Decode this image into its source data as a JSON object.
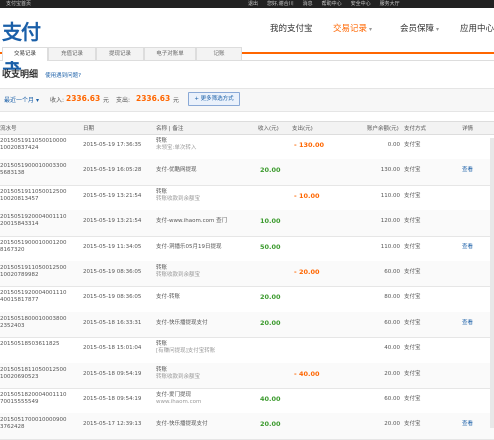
{
  "topbar": {
    "left": "支付宝首页",
    "links": [
      "退出",
      "您好,谢合川",
      "消息",
      "帮助中心",
      "安全中心",
      "服务大厅"
    ]
  },
  "header": {
    "logo": "支付宝",
    "nav": [
      {
        "label": "我的支付宝",
        "active": false,
        "caret": false
      },
      {
        "label": "交易记录",
        "active": true,
        "caret": true
      },
      {
        "label": "会员保障",
        "active": false,
        "caret": true
      },
      {
        "label": "应用中心",
        "active": false,
        "caret": true
      }
    ]
  },
  "subtabs": [
    "交易记录",
    "充值记录",
    "提现记录",
    "电子对账单",
    "记账"
  ],
  "page": {
    "title": "收支明细",
    "hint": "使用遇到问题?"
  },
  "filter": {
    "range": "最近一个月",
    "income_label": "收入:",
    "income": "2336.63",
    "expense_label": "支出:",
    "expense": "2336.63",
    "unit": "元",
    "more_button": "更多筛选方式"
  },
  "table": {
    "headers": [
      "流水号",
      "日期",
      "名称 | 备注",
      "收入(元)",
      "支出(元)",
      "账户余额(元)",
      "支付方式",
      "详情"
    ],
    "rows": [
      {
        "no1": "2015051911050010000",
        "no2": "10020837424",
        "date": "2015-05-19 17:36:35",
        "name": "转账",
        "sub": "未领宝:单次转入",
        "in": "",
        "out": "- 130.00",
        "bal": "0.00",
        "method": "支付宝",
        "detail": ""
      },
      {
        "no1": "2015051900010003300",
        "no2": "5683138",
        "date": "2015-05-19 16:05:28",
        "name": "支付-优酷网提现",
        "sub": "",
        "in": "20.00",
        "out": "",
        "bal": "130.00",
        "method": "支付宝",
        "detail": "查看"
      },
      {
        "no1": "2015051911050012500",
        "no2": "10020813457",
        "date": "2015-05-19 13:21:54",
        "name": "转账",
        "sub": "转账收款到余额宝",
        "in": "",
        "out": "- 10.00",
        "bal": "110.00",
        "method": "支付宝",
        "detail": ""
      },
      {
        "no1": "2015051920004001110",
        "no2": "20015843314",
        "date": "2015-05-19 13:21:54",
        "name": "支付-www.ihaom.com 查门",
        "sub": "",
        "in": "10.00",
        "out": "",
        "bal": "120.00",
        "method": "支付宝",
        "detail": ""
      },
      {
        "no1": "2015051900010001200",
        "no2": "8167320",
        "date": "2015-05-19 11:34:05",
        "name": "支付-洞播乐05月19日提现",
        "sub": "",
        "in": "50.00",
        "out": "",
        "bal": "110.00",
        "method": "支付宝",
        "detail": "查看"
      },
      {
        "no1": "2015051911050012500",
        "no2": "10020789982",
        "date": "2015-05-19 08:36:05",
        "name": "转账",
        "sub": "转账收款到余额宝",
        "in": "",
        "out": "- 20.00",
        "bal": "60.00",
        "method": "支付宝",
        "detail": ""
      },
      {
        "no1": "2015051920004001110",
        "no2": "40015817877",
        "date": "2015-05-19 08:36:05",
        "name": "支付-转账",
        "sub": "",
        "in": "20.00",
        "out": "",
        "bal": "80.00",
        "method": "支付宝",
        "detail": ""
      },
      {
        "no1": "2015051800010003800",
        "no2": "2352403",
        "date": "2015-05-18 16:33:31",
        "name": "支付-快乐播提现支付",
        "sub": "",
        "in": "20.00",
        "out": "",
        "bal": "60.00",
        "method": "支付宝",
        "detail": "查看"
      },
      {
        "no1": "20150518503611825",
        "no2": "",
        "date": "2015-05-18 15:01:04",
        "name": "转账",
        "sub": "[有赚问提现]支付宝转账",
        "in": "",
        "out": "",
        "bal": "40.00",
        "method": "支付宝",
        "detail": ""
      },
      {
        "no1": "2015051811050012500",
        "no2": "10020690523",
        "date": "2015-05-18 09:54:19",
        "name": "转账",
        "sub": "转账收款到余额宝",
        "in": "",
        "out": "- 40.00",
        "bal": "20.00",
        "method": "支付宝",
        "detail": ""
      },
      {
        "no1": "2015051820004001110",
        "no2": "70015555549",
        "date": "2015-05-18 09:54:19",
        "name": "支付-爱门提现",
        "sub": "www.ihaom.com",
        "in": "40.00",
        "out": "",
        "bal": "60.00",
        "method": "支付宝",
        "detail": ""
      },
      {
        "no1": "2015051700010000900",
        "no2": "3762428",
        "date": "2015-05-17 12:39:13",
        "name": "支付-快乐播提现支付",
        "sub": "",
        "in": "20.00",
        "out": "",
        "bal": "20.00",
        "method": "支付宝",
        "detail": "查看"
      }
    ]
  },
  "colors": {
    "accent": "#ff6600",
    "link": "#1a5fa8",
    "income": "#3a9a2c",
    "topbar": "#222222"
  }
}
